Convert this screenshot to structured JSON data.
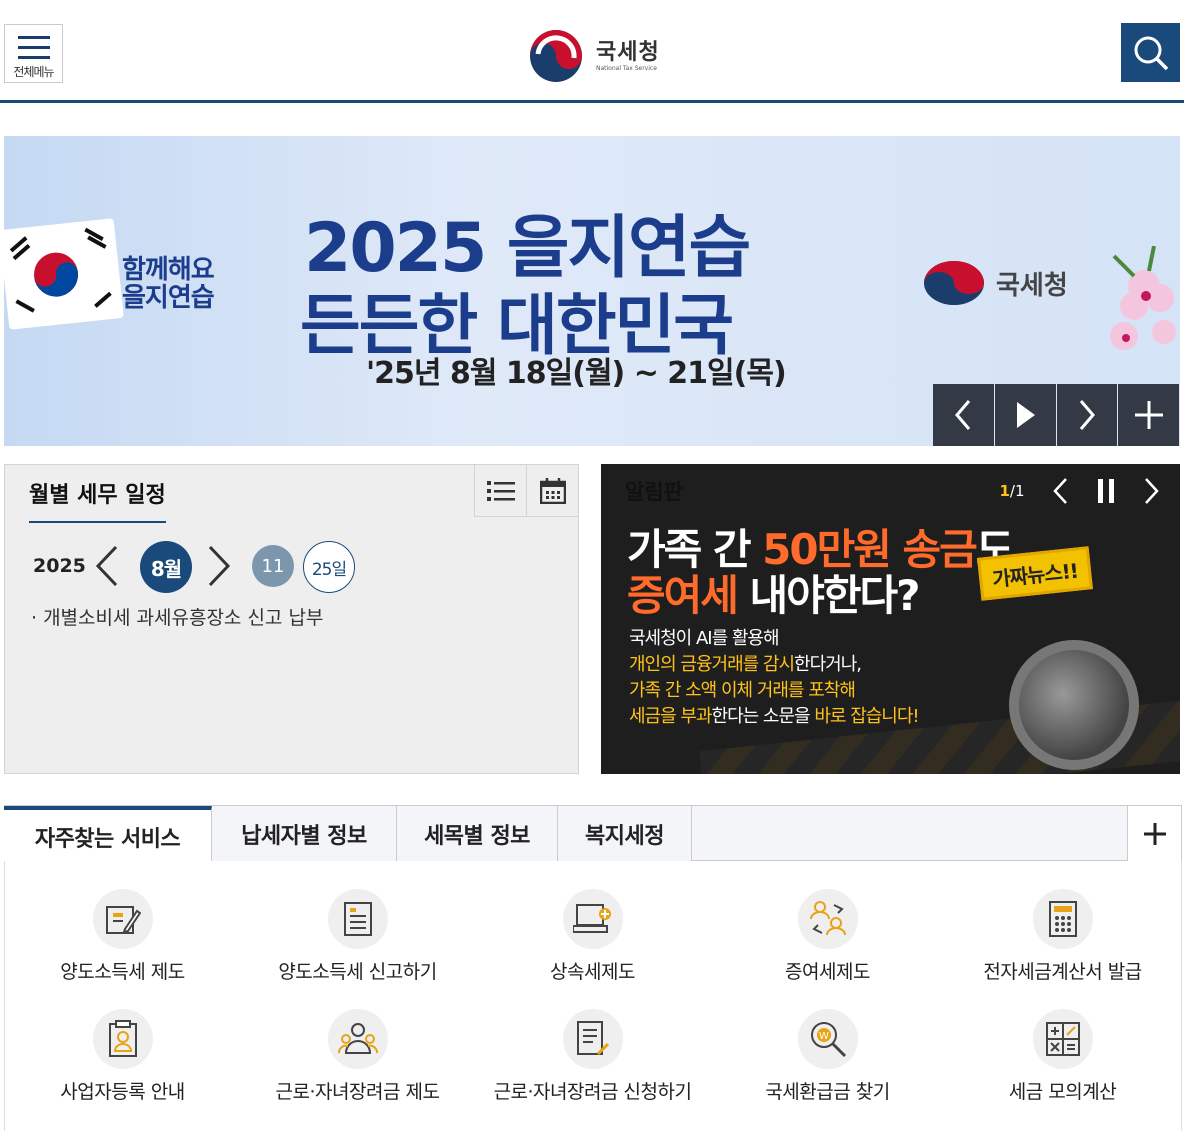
{
  "header": {
    "menu_label": "전체메뉴",
    "logo_name": "국세청",
    "logo_english": "National Tax Service"
  },
  "banner": {
    "slogan_line1": "함께해요",
    "slogan_line2": "을지연습",
    "title_line1": "2025 을지연습",
    "title_line2": "든든한 대한민국",
    "date": "'25년 8월 18일(월) ~ 21일(목)",
    "org": "국세청"
  },
  "schedule": {
    "title": "월별 세무 일정",
    "year": "2025",
    "month": "8월",
    "day_a": "11",
    "day_b": "25일",
    "item": "· 개별소비세 과세유흥장소 신고 납부"
  },
  "notice": {
    "board_label": "알림판",
    "page_current": "1",
    "page_total": "/1",
    "headline1_a": "가족 간 ",
    "headline1_b": "50만원 송금",
    "headline1_c": "도",
    "headline2_a": "증여세",
    "headline2_b": " 내야한다?",
    "fake_badge": "가짜뉴스!!",
    "body1": "국세청이 AI를 활용해",
    "body2_a": "개인의 금융거래를 감시",
    "body2_b": "한다거나,",
    "body3_a": "가족 간 소액 이체 거래를",
    "body3_b": " 포착해",
    "body4_a": "세금을 부과",
    "body4_b": "한다는 소문을",
    "body4_c": " 바로 잡습니다!"
  },
  "tabs": [
    {
      "label": "자주찾는 서비스"
    },
    {
      "label": "납세자별 정보"
    },
    {
      "label": "세목별 정보"
    },
    {
      "label": "복지세정"
    }
  ],
  "services": [
    {
      "label": "양도소득세 제도",
      "icon": "pencil-document-icon"
    },
    {
      "label": "양도소득세 신고하기",
      "icon": "form-document-icon"
    },
    {
      "label": "상속세제도",
      "icon": "computer-plus-icon"
    },
    {
      "label": "증여세제도",
      "icon": "people-exchange-icon"
    },
    {
      "label": "전자세금계산서 발급",
      "icon": "calculator-icon"
    },
    {
      "label": "사업자등록 안내",
      "icon": "clipboard-person-icon"
    },
    {
      "label": "근로·자녀장려금 제도",
      "icon": "people-group-icon"
    },
    {
      "label": "근로·자녀장려금 신청하기",
      "icon": "document-pen-icon"
    },
    {
      "label": "국세환급금 찾기",
      "icon": "magnifier-won-icon"
    },
    {
      "label": "세금 모의계산",
      "icon": "calc-symbols-icon"
    }
  ],
  "colors": {
    "brand": "#1a4a7c",
    "accent": "#ffc21a",
    "banner_blue": "#1b3d8c"
  }
}
